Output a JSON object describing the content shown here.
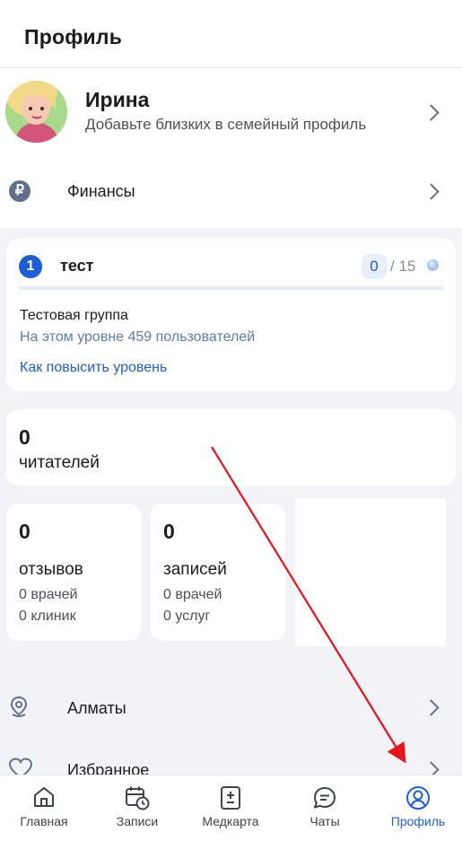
{
  "header": {
    "title": "Профиль"
  },
  "profile": {
    "name": "Ирина",
    "subtitle": "Добавьте близких в семейный профиль"
  },
  "finance": {
    "label": "Финансы",
    "icon": "ruble-icon",
    "symbol": "₽"
  },
  "level": {
    "number": "1",
    "name": "тест",
    "current": "0",
    "total": "/ 15",
    "progress": 0,
    "group": "Тестовая группа",
    "users": "На этом уровне 459 пользователей",
    "link": "Как повысить уровень"
  },
  "readers": {
    "count": "0",
    "label": "читателей"
  },
  "reviews": {
    "count": "0",
    "label": "отзывов",
    "doctors": "0 врачей",
    "clinics": "0 клиник"
  },
  "records": {
    "count": "0",
    "label": "записей",
    "doctors": "0 врачей",
    "services": "0 услуг"
  },
  "list": [
    {
      "label": "Алматы",
      "icon": "location-pin-icon"
    },
    {
      "label": "Избранное",
      "icon": "heart-icon"
    }
  ],
  "tabs": [
    {
      "label": "Главная",
      "icon": "home-icon"
    },
    {
      "label": "Записи",
      "icon": "calendar-clock-icon"
    },
    {
      "label": "Медкарта",
      "icon": "medical-record-icon"
    },
    {
      "label": "Чаты",
      "icon": "chat-icon"
    },
    {
      "label": "Профиль",
      "icon": "profile-icon",
      "active": true
    }
  ],
  "colors": {
    "accent": "#1e5fd8",
    "annotation_arrow": "#e8141b",
    "background": "#f1f3f7"
  }
}
